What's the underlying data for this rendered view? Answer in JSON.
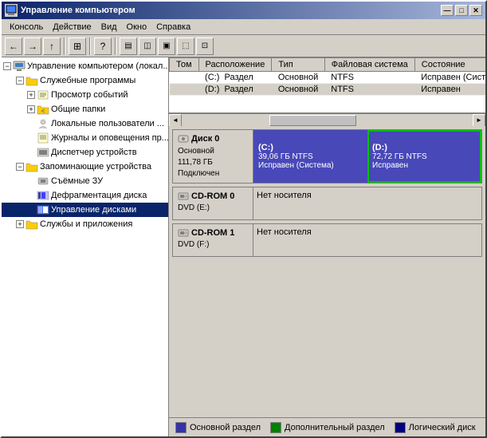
{
  "window": {
    "title": "Управление компьютером",
    "min_btn": "—",
    "max_btn": "□",
    "close_btn": "✕"
  },
  "menubar": {
    "items": [
      "Консоль",
      "Действие",
      "Вид",
      "Окно",
      "Справка"
    ]
  },
  "toolbar": {
    "buttons": [
      "←",
      "→",
      "↑",
      "⊞",
      "?",
      "⬜",
      "⬜",
      "⬜",
      "⬜"
    ]
  },
  "tree": {
    "items": [
      {
        "indent": 0,
        "label": "Управление компьютером (локал...",
        "toggle": "−",
        "has_toggle": true
      },
      {
        "indent": 1,
        "label": "Служебные программы",
        "toggle": "−",
        "has_toggle": true
      },
      {
        "indent": 2,
        "label": "Просмотр событий",
        "toggle": "+",
        "has_toggle": true
      },
      {
        "indent": 2,
        "label": "Общие папки",
        "toggle": "+",
        "has_toggle": true
      },
      {
        "indent": 2,
        "label": "Локальные пользователи ...",
        "toggle": "+",
        "has_toggle": false
      },
      {
        "indent": 2,
        "label": "Журналы и оповещения пр...",
        "toggle": "+",
        "has_toggle": false
      },
      {
        "indent": 2,
        "label": "Диспетчер устройств",
        "toggle": "",
        "has_toggle": false
      },
      {
        "indent": 1,
        "label": "Запоминающие устройства",
        "toggle": "−",
        "has_toggle": true
      },
      {
        "indent": 2,
        "label": "Съёмные ЗУ",
        "toggle": "",
        "has_toggle": false
      },
      {
        "indent": 2,
        "label": "Дефрагментация диска",
        "toggle": "",
        "has_toggle": false
      },
      {
        "indent": 2,
        "label": "Управление дисками",
        "toggle": "",
        "has_toggle": false,
        "selected": true
      },
      {
        "indent": 1,
        "label": "Службы и приложения",
        "toggle": "+",
        "has_toggle": true
      }
    ]
  },
  "top_table": {
    "columns": [
      "Том",
      "Расположение",
      "Тип",
      "Файловая система",
      "Состояние"
    ],
    "rows": [
      {
        "vol": "",
        "loc": "(C:)  Раздел",
        "type": "Основной",
        "fs": "NTFS",
        "status": "Исправен (Систем..."
      },
      {
        "vol": "",
        "loc": "(D:)  Раздел",
        "type": "Основной",
        "fs": "NTFS",
        "status": "Исправен"
      }
    ]
  },
  "disks": [
    {
      "name": "Диск 0",
      "info": "Основной\n111,78 ГБ\nПодключен",
      "partitions": [
        {
          "label": "(C:)",
          "detail": "39,06 ГБ NTFS\nИсправен (Система)",
          "type": "primary",
          "selected": false
        },
        {
          "label": "(D:)",
          "detail": "72,72 ГБ NTFS\nИсправен",
          "type": "primary",
          "selected": true
        }
      ]
    }
  ],
  "cdroms": [
    {
      "name": "CD-ROM 0",
      "sub": "DVD (E:)",
      "status": "Нет носителя"
    },
    {
      "name": "CD-ROM 1",
      "sub": "DVD (F:)",
      "status": "Нет носителя"
    }
  ],
  "legend": {
    "items": [
      {
        "color": "primary",
        "label": "Основной раздел"
      },
      {
        "color": "extended",
        "label": "Дополнительный раздел"
      },
      {
        "color": "logical",
        "label": "Логический диск"
      }
    ]
  }
}
